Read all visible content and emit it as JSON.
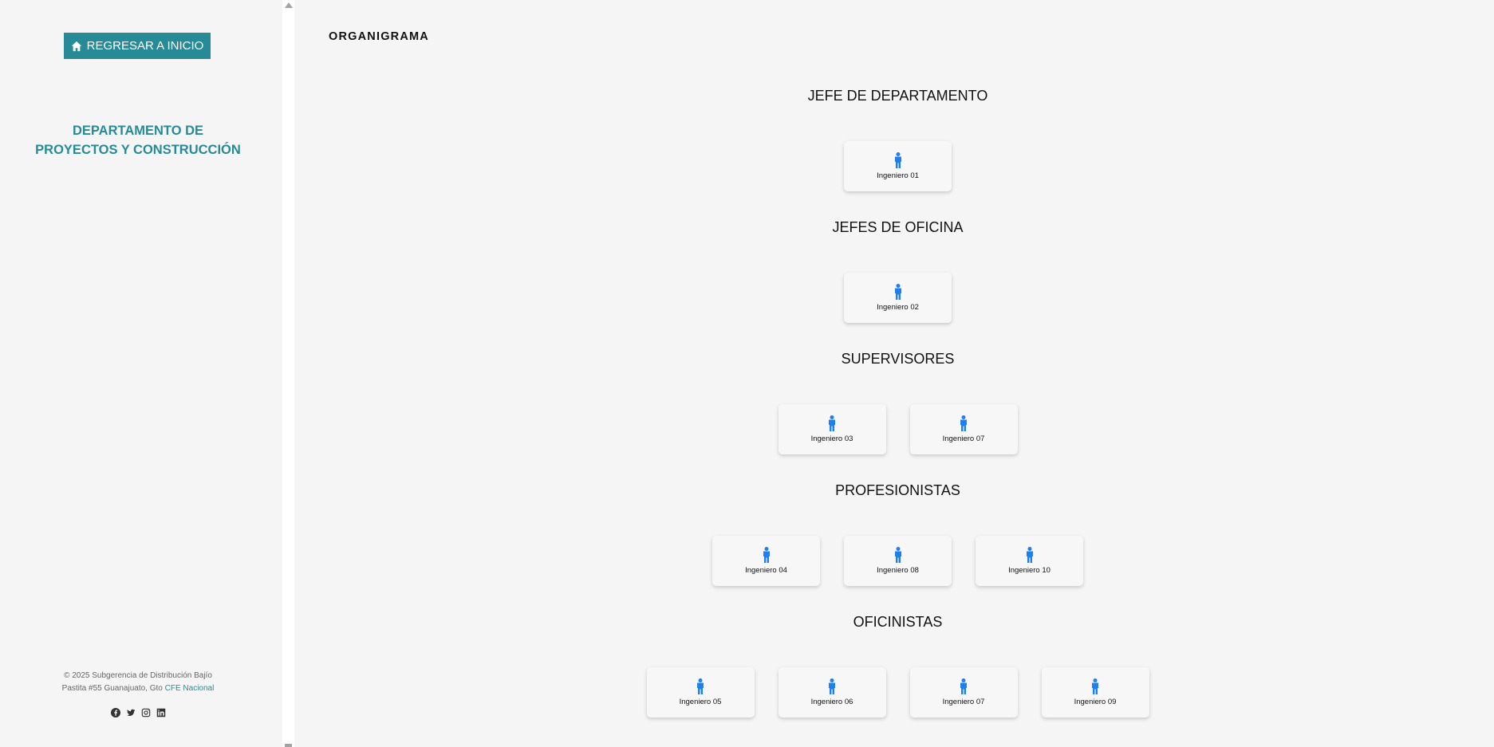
{
  "sidebar": {
    "home_button_label": "REGRESAR A INICIO",
    "dept_line1": "DEPARTAMENTO DE",
    "dept_line2": "PROYECTOS Y CONSTRUCCIÓN",
    "footer_line1": "© 2025 Subgerencia de Distribución Bajío",
    "footer_address": "Pastita #55 Guanajuato, Gto",
    "footer_link": "CFE Nacional",
    "socials": [
      "facebook-icon",
      "twitter-icon",
      "instagram-icon",
      "linkedin-icon"
    ]
  },
  "main": {
    "title": "ORGANIGRAMA",
    "sections": [
      {
        "title": "JEFE DE DEPARTAMENTO",
        "members": [
          "Ingeniero 01"
        ]
      },
      {
        "title": "JEFES DE OFICINA",
        "members": [
          "Ingeniero 02"
        ]
      },
      {
        "title": "SUPERVISORES",
        "members": [
          "Ingeniero 03",
          "Ingeniero 07"
        ]
      },
      {
        "title": "PROFESIONISTAS",
        "members": [
          "Ingeniero 04",
          "Ingeniero 08",
          "Ingeniero 10"
        ]
      },
      {
        "title": "OFICINISTAS",
        "members": [
          "Ingeniero 05",
          "Ingeniero 06",
          "Ingeniero 07",
          "Ingeniero 09"
        ]
      }
    ]
  },
  "colors": {
    "accent": "#268b96",
    "person_icon": "#1e7ff0",
    "background": "#f5f5f5"
  }
}
